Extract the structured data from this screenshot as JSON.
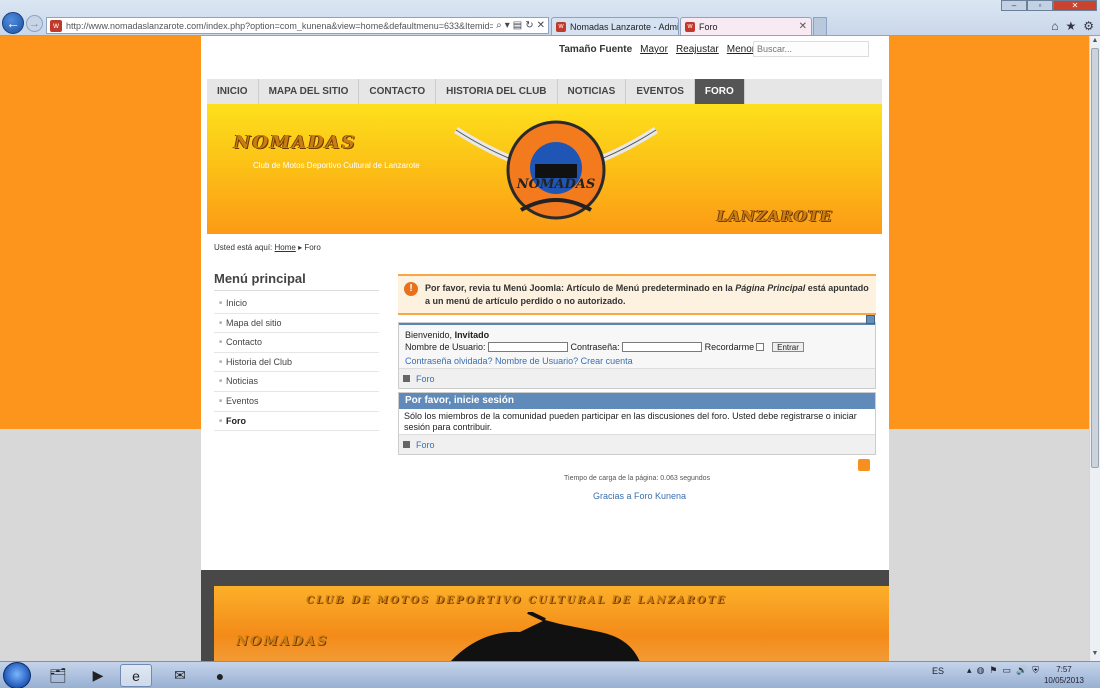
{
  "browser": {
    "url": "http://www.nomadaslanzarote.com/index.php?option=com_kunena&view=home&defaultmenu=633&Itemid=634",
    "tabs": [
      {
        "title": "Nomadas Lanzarote - Adminis..."
      },
      {
        "title": "Foro"
      }
    ],
    "favicon": "w"
  },
  "page": {
    "font_tools": {
      "label": "Tamaño Fuente",
      "bigger": "Mayor",
      "reset": "Reajustar",
      "smaller": "Menor"
    },
    "search": {
      "placeholder": "Buscar..."
    },
    "nav": [
      "INICIO",
      "MAPA DEL SITIO",
      "CONTACTO",
      "HISTORIA DEL CLUB",
      "NOTICIAS",
      "EVENTOS",
      "FORO"
    ],
    "nav_active_index": 6,
    "banner": {
      "title": "NOMADAS",
      "subtitle": "Club de Motos Deportivo Cultural de Lanzarote",
      "logo_name": "NOMADAS",
      "island": "LANZAROTE"
    },
    "breadcrumb": {
      "prefix": "Usted está aquí:",
      "home": "Home",
      "current": "Foro"
    },
    "sidebar": {
      "title": "Menú principal",
      "items": [
        "Inicio",
        "Mapa del sitio",
        "Contacto",
        "Historia del Club",
        "Noticias",
        "Eventos",
        "Foro"
      ],
      "active_index": 6
    },
    "system_message": {
      "part1": "Por favor, revia tu Menú Joomla: Artículo de Menú predeterminado en la ",
      "emph": "Página Principal",
      "part2": " está apuntado a un menú de artículo perdido o no autorizado."
    },
    "login": {
      "welcome": "Bienvenido,",
      "guest": "Invitado",
      "username_label": "Nombre de Usuario:",
      "password_label": "Contraseña:",
      "remember_label": "Recordarme",
      "submit": "Entrar",
      "links": "Contraseña olvidada? Nombre de Usuario? Crear cuenta",
      "forum_link": "Foro"
    },
    "notice": {
      "title": "Por favor, inicie sesión",
      "body": "Sólo los miembros de la comunidad pueden participar en las discusiones del foro. Usted debe registrarse o iniciar sesión para contribuir.",
      "forum_link": "Foro"
    },
    "load_time": "Tiempo de carga de la página: 0.063 segundos",
    "credit": "Gracias a Foro Kunena",
    "footer": {
      "line1": "CLUB DE MOTOS DEPORTIVO CULTURAL DE LANZAROTE",
      "line2": "NOMADAS"
    }
  },
  "taskbar": {
    "language": "ES",
    "time": "7:57",
    "date": "10/05/2013"
  },
  "colors": {
    "orange": "#fd951d",
    "nav_active": "#555555",
    "link": "#3b6fb0",
    "notice_header": "#5f8ab9"
  }
}
